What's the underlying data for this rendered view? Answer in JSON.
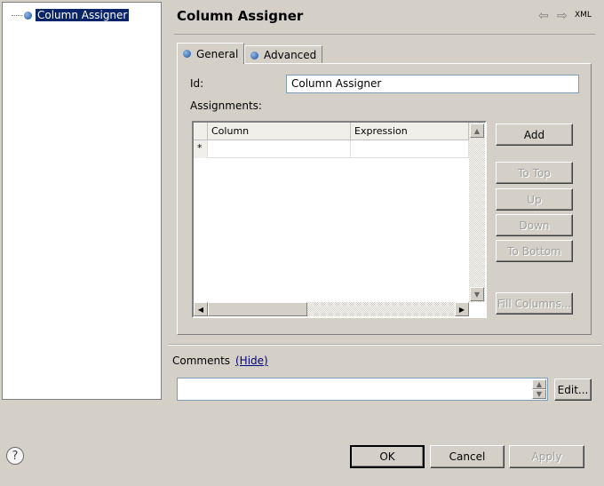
{
  "tree": {
    "selected_item": "Column Assigner"
  },
  "header": {
    "title": "Column Assigner",
    "xml_label": "XML",
    "back_icon": "arrow-left-icon",
    "forward_icon": "arrow-right-icon"
  },
  "tabs": [
    {
      "label": "General"
    },
    {
      "label": "Advanced"
    }
  ],
  "general": {
    "id_label": "Id:",
    "id_value": "Column Assigner",
    "assignments_label": "Assignments:",
    "table": {
      "columns": [
        "Column",
        "Expression"
      ],
      "new_row_marker": "*",
      "rows": []
    },
    "buttons": {
      "add": "Add",
      "to_top": "To Top",
      "up": "Up",
      "down": "Down",
      "to_bottom": "To Bottom",
      "fill_columns": "Fill Columns..."
    }
  },
  "comments": {
    "label": "Comments",
    "hide_link": "(Hide)",
    "value": "",
    "edit_button": "Edit..."
  },
  "footer": {
    "help_icon": "help-icon",
    "ok": "OK",
    "cancel": "Cancel",
    "apply": "Apply"
  }
}
